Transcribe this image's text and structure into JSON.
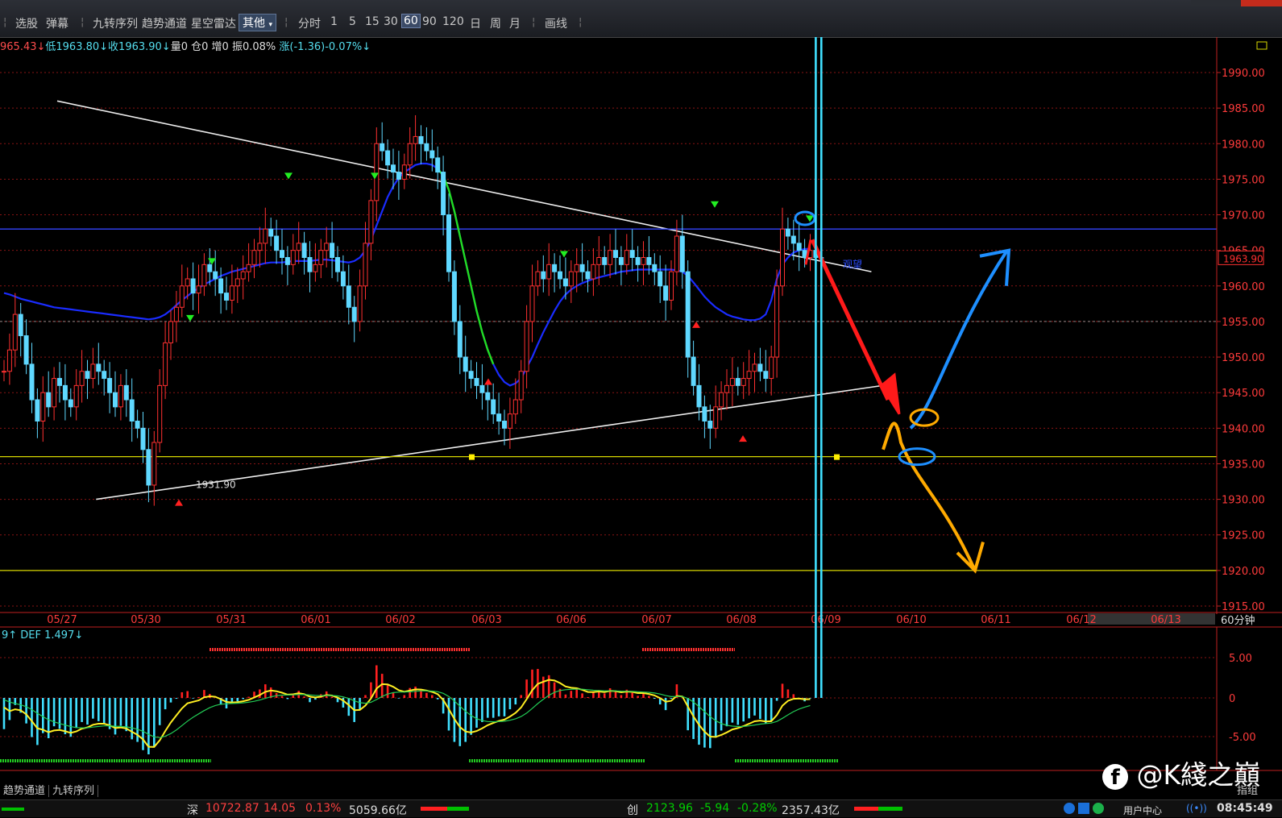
{
  "toolbar": {
    "items": [
      "选股",
      "弹幕",
      "九转序列",
      "趋势通道",
      "星空雷达"
    ],
    "dropdown": "其他",
    "periods": [
      "分时",
      "1",
      "5",
      "15",
      "30",
      "60",
      "90",
      "120",
      "日",
      "周",
      "月"
    ],
    "active_period": "60",
    "draw": "画线"
  },
  "infobar": {
    "open_part": "965.43↓",
    "low": "低1963.80↓",
    "close": "收1963.90↓",
    "vol": "量0",
    "pos": "仓0",
    "inc": "增0",
    "amp": "振0.08%",
    "chg": "涨(-1.36)-0.07%↓"
  },
  "chart_data": {
    "type": "candlestick",
    "y_ticks": [
      1990,
      1985,
      1980,
      1975,
      1970,
      1965,
      1960,
      1955,
      1950,
      1945,
      1940,
      1935,
      1930,
      1925,
      1920,
      1915
    ],
    "y_tick_labels": [
      "1990.00",
      "1985.00",
      "1980.00",
      "1975.00",
      "1970.00",
      "1965.00",
      "1960.00",
      "1955.00",
      "1950.00",
      "1945.00",
      "1940.00",
      "1935.00",
      "1930.00",
      "1925.00",
      "1920.00",
      "1915.00"
    ],
    "ylim": [
      1913.5,
      1995
    ],
    "x_labels": [
      "05/27",
      "05/30",
      "05/31",
      "06/01",
      "06/02",
      "06/03",
      "06/06",
      "06/07",
      "06/08",
      "06/09",
      "06/10",
      "06/11",
      "06/12",
      "06/13"
    ],
    "last_price": "1963.90",
    "low_label": "1931.90",
    "period_label": "60分钟",
    "annotation": "观望",
    "prices": [
      1948,
      1951,
      1956,
      1953,
      1949,
      1944,
      1941,
      1945,
      1943,
      1947,
      1946,
      1944,
      1943,
      1946,
      1948,
      1947,
      1949,
      1948,
      1947,
      1945,
      1943,
      1946,
      1944,
      1941,
      1940,
      1937,
      1932,
      1938,
      1946,
      1952,
      1955,
      1957,
      1960,
      1961,
      1959,
      1960,
      1963,
      1962,
      1961,
      1959,
      1958,
      1960,
      1961,
      1962,
      1963,
      1965,
      1966,
      1968,
      1967,
      1965,
      1964,
      1963,
      1965,
      1966,
      1964,
      1962,
      1963,
      1965,
      1966,
      1964,
      1962,
      1960,
      1957,
      1955,
      1960,
      1966,
      1972,
      1980,
      1979,
      1977,
      1976,
      1975,
      1977,
      1980,
      1981,
      1980,
      1979,
      1978,
      1976,
      1970,
      1962,
      1955,
      1950,
      1948,
      1947,
      1946,
      1945,
      1944,
      1942,
      1941,
      1940,
      1942,
      1944,
      1948,
      1955,
      1960,
      1962,
      1961,
      1963,
      1962,
      1961,
      1960,
      1962,
      1963,
      1962,
      1961,
      1963,
      1964,
      1963,
      1965,
      1964,
      1963,
      1965,
      1964,
      1963,
      1964,
      1963,
      1962,
      1960,
      1958,
      1962,
      1967,
      1962,
      1950,
      1946,
      1943,
      1941,
      1940,
      1943,
      1945,
      1946,
      1947,
      1946,
      1947,
      1948,
      1949,
      1948,
      1947,
      1950,
      1960,
      1968,
      1967,
      1966,
      1965,
      1964,
      1965,
      1964,
      1963.9
    ],
    "ma": [
      1959,
      1958.8,
      1958.5,
      1958.2,
      1958,
      1957.8,
      1957.6,
      1957.4,
      1957.2,
      1957,
      1956.9,
      1956.8,
      1956.7,
      1956.6,
      1956.5,
      1956.4,
      1956.3,
      1956.2,
      1956.1,
      1956,
      1955.9,
      1955.8,
      1955.7,
      1955.6,
      1955.5,
      1955.4,
      1955.3,
      1955.4,
      1955.6,
      1956,
      1956.6,
      1957.3,
      1958,
      1958.6,
      1959.2,
      1959.7,
      1960.2,
      1960.6,
      1961,
      1961.4,
      1961.7,
      1962,
      1962.2,
      1962.4,
      1962.6,
      1962.8,
      1963,
      1963.2,
      1963.3,
      1963.3,
      1963.3,
      1963.4,
      1963.5,
      1963.5,
      1963.5,
      1963.5,
      1963.6,
      1963.7,
      1963.7,
      1963.6,
      1963.5,
      1963.4,
      1963.3,
      1963.5,
      1964,
      1965,
      1966.5,
      1968.5,
      1970.5,
      1972.5,
      1974,
      1975.2,
      1976,
      1976.5,
      1977,
      1977.2,
      1977.2,
      1977,
      1976.5,
      1975.5,
      1973.5,
      1970.5,
      1967,
      1963.5,
      1960,
      1956.5,
      1953.5,
      1951,
      1949,
      1947.5,
      1946.5,
      1946,
      1946.3,
      1947,
      1948.5,
      1950,
      1951.8,
      1953.5,
      1955,
      1956.5,
      1957.8,
      1958.8,
      1959.5,
      1960,
      1960.4,
      1960.7,
      1961,
      1961.2,
      1961.4,
      1961.6,
      1961.8,
      1962,
      1962.1,
      1962.2,
      1962.3,
      1962.3,
      1962.3,
      1962.3,
      1962.3,
      1962.3,
      1962.3,
      1962.2,
      1962,
      1961.4,
      1960.5,
      1959.5,
      1958.5,
      1957.7,
      1957,
      1956.5,
      1956,
      1955.7,
      1955.5,
      1955.3,
      1955.2,
      1955.2,
      1955.4,
      1956,
      1958,
      1961,
      1963,
      1964,
      1964.7,
      1965,
      1965.2,
      1965.2
    ],
    "trendlines": [
      {
        "from": [
          0,
          1986
        ],
        "to": [
          156,
          1962
        ]
      },
      {
        "from": [
          7,
          1930
        ],
        "to": [
          158,
          1946
        ]
      },
      {
        "h": 1968,
        "color": "#3344ff"
      },
      {
        "h": 1936,
        "color": "#d8d800"
      },
      {
        "h": 1920,
        "color": "#d8d800"
      }
    ]
  },
  "indicator": {
    "label": "9↑ DEF 1.497↓",
    "y_tick_labels": [
      "5.00",
      "0",
      "-5.00"
    ]
  },
  "bottom_tabs": [
    "趋势通道",
    "九转序列"
  ],
  "bottom_right": "指组",
  "status": {
    "sz_label": "深",
    "sz_index": "10722.87",
    "sz_chg": "14.05",
    "sz_pct": "0.13%",
    "sz_amt": "5059.66亿",
    "cy_label": "创",
    "cy_index": "2123.96",
    "cy_chg": "-5.94",
    "cy_pct": "-0.28%",
    "cy_amt": "2357.43亿",
    "user_center": "用户中心",
    "time": "08:45:49"
  },
  "watermark": "@K綫之巔"
}
